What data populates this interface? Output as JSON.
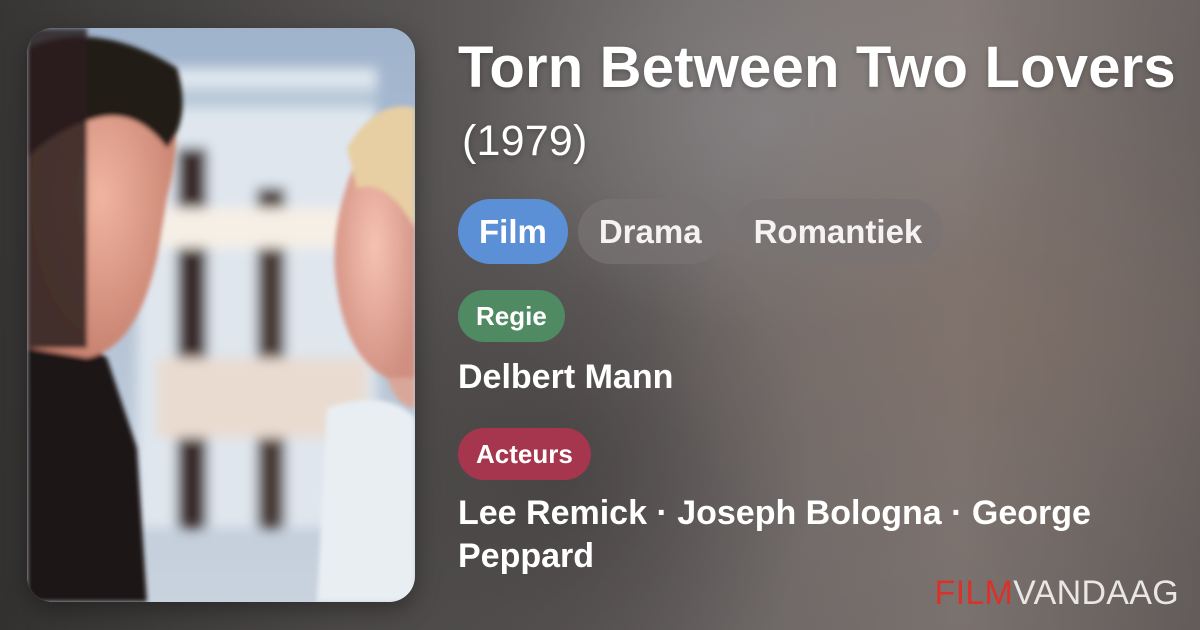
{
  "movie": {
    "title": "Torn Between Two Lovers",
    "year": "(1979)"
  },
  "tags": [
    "Film",
    "Drama",
    "Romantiek"
  ],
  "director": {
    "label": "Regie",
    "name": "Delbert Mann"
  },
  "actors": {
    "label": "Acteurs",
    "names": "Lee Remick · Joseph Bologna · George Peppard"
  },
  "brand": {
    "part1": "FILM",
    "part2": "VANDAAG"
  },
  "colors": {
    "tag_primary": "#5b8fd6",
    "regie_badge": "#4f8a63",
    "acteurs_badge": "#a5364e",
    "brand_red": "#d9322b"
  }
}
